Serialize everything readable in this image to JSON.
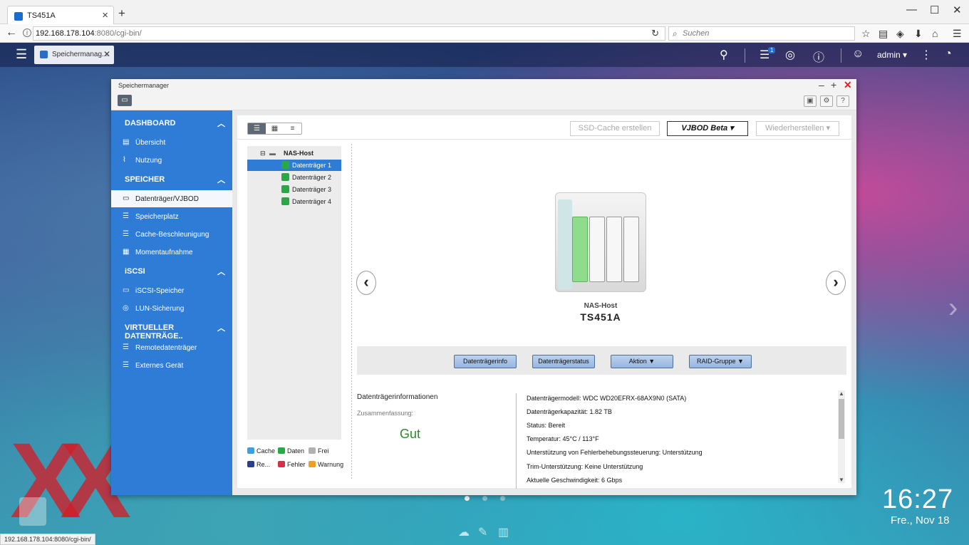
{
  "browser": {
    "tab_title": "TS451A",
    "tab_close": "×",
    "new_tab": "+",
    "url_host": "192.168.178.104",
    "url_rest": ":8080/cgi-bin/",
    "search_placeholder": "Suchen",
    "status_url": "192.168.178.104:8080/cgi-bin/"
  },
  "qts_topbar": {
    "app_tab_label": "Speichermanag...",
    "notification_count": "1",
    "user": "admin ▾"
  },
  "window": {
    "title": "Speichermanager"
  },
  "sidebar": {
    "sections": [
      {
        "title": "DASHBOARD",
        "items": [
          "Übersicht",
          "Nutzung"
        ]
      },
      {
        "title": "SPEICHER",
        "items": [
          "Datenträger/VJBOD",
          "Speicherplatz",
          "Cache-Beschleunigung",
          "Momentaufnahme"
        ]
      },
      {
        "title": "iSCSI",
        "items": [
          "iSCSI-Speicher",
          "LUN-Sicherung"
        ]
      },
      {
        "title": "VIRTUELLER DATENTRÄGE..",
        "items": [
          "Remotedatenträger",
          "Externes Gerät"
        ]
      }
    ]
  },
  "toolbar": {
    "ssd_cache": "SSD-Cache erstellen",
    "vjbod": "VJBOD Beta ▾",
    "restore": "Wiederherstellen ▾"
  },
  "tree": {
    "root": "NAS-Host",
    "disks": [
      "Datenträger 1",
      "Datenträger 2",
      "Datenträger 3",
      "Datenträger 4"
    ],
    "selected_index": 0
  },
  "legend": [
    {
      "label": "Cache",
      "color": "#3aa0e0"
    },
    {
      "label": "Daten",
      "color": "#2aa845"
    },
    {
      "label": "Frei",
      "color": "#b0b0b0"
    },
    {
      "label": "Re...",
      "color": "#2a3f8f"
    },
    {
      "label": "Fehler",
      "color": "#d8304a"
    },
    {
      "label": "Warnung",
      "color": "#f0a020"
    }
  ],
  "device": {
    "caption_label": "NAS-Host",
    "caption_model": "TS451A",
    "bays_green": [
      true,
      false,
      false,
      false
    ]
  },
  "actions": {
    "info": "Datenträgerinfo",
    "status": "Datenträgerstatus",
    "action": "Aktion ▼",
    "raid": "RAID-Gruppe ▼"
  },
  "info": {
    "heading": "Datenträgerinformationen",
    "summary_label": "Zusammenfassung:",
    "summary_value": "Gut",
    "lines": [
      "Datenträgermodell: WDC WD20EFRX-68AX9N0 (SATA)",
      "Datenträgerkapazität: 1.82 TB",
      "Status: Bereit",
      "Temperatur: 45°C / 113°F",
      "Unterstützung von Fehlerbehebungssteuerung: Unterstützung",
      "Trim-Unterstützung: Keine Unterstützung",
      "Aktuelle Geschwindigkeit: 6 Gbps"
    ]
  },
  "desktop": {
    "time": "16:27",
    "date": "Fre., Nov 18"
  }
}
